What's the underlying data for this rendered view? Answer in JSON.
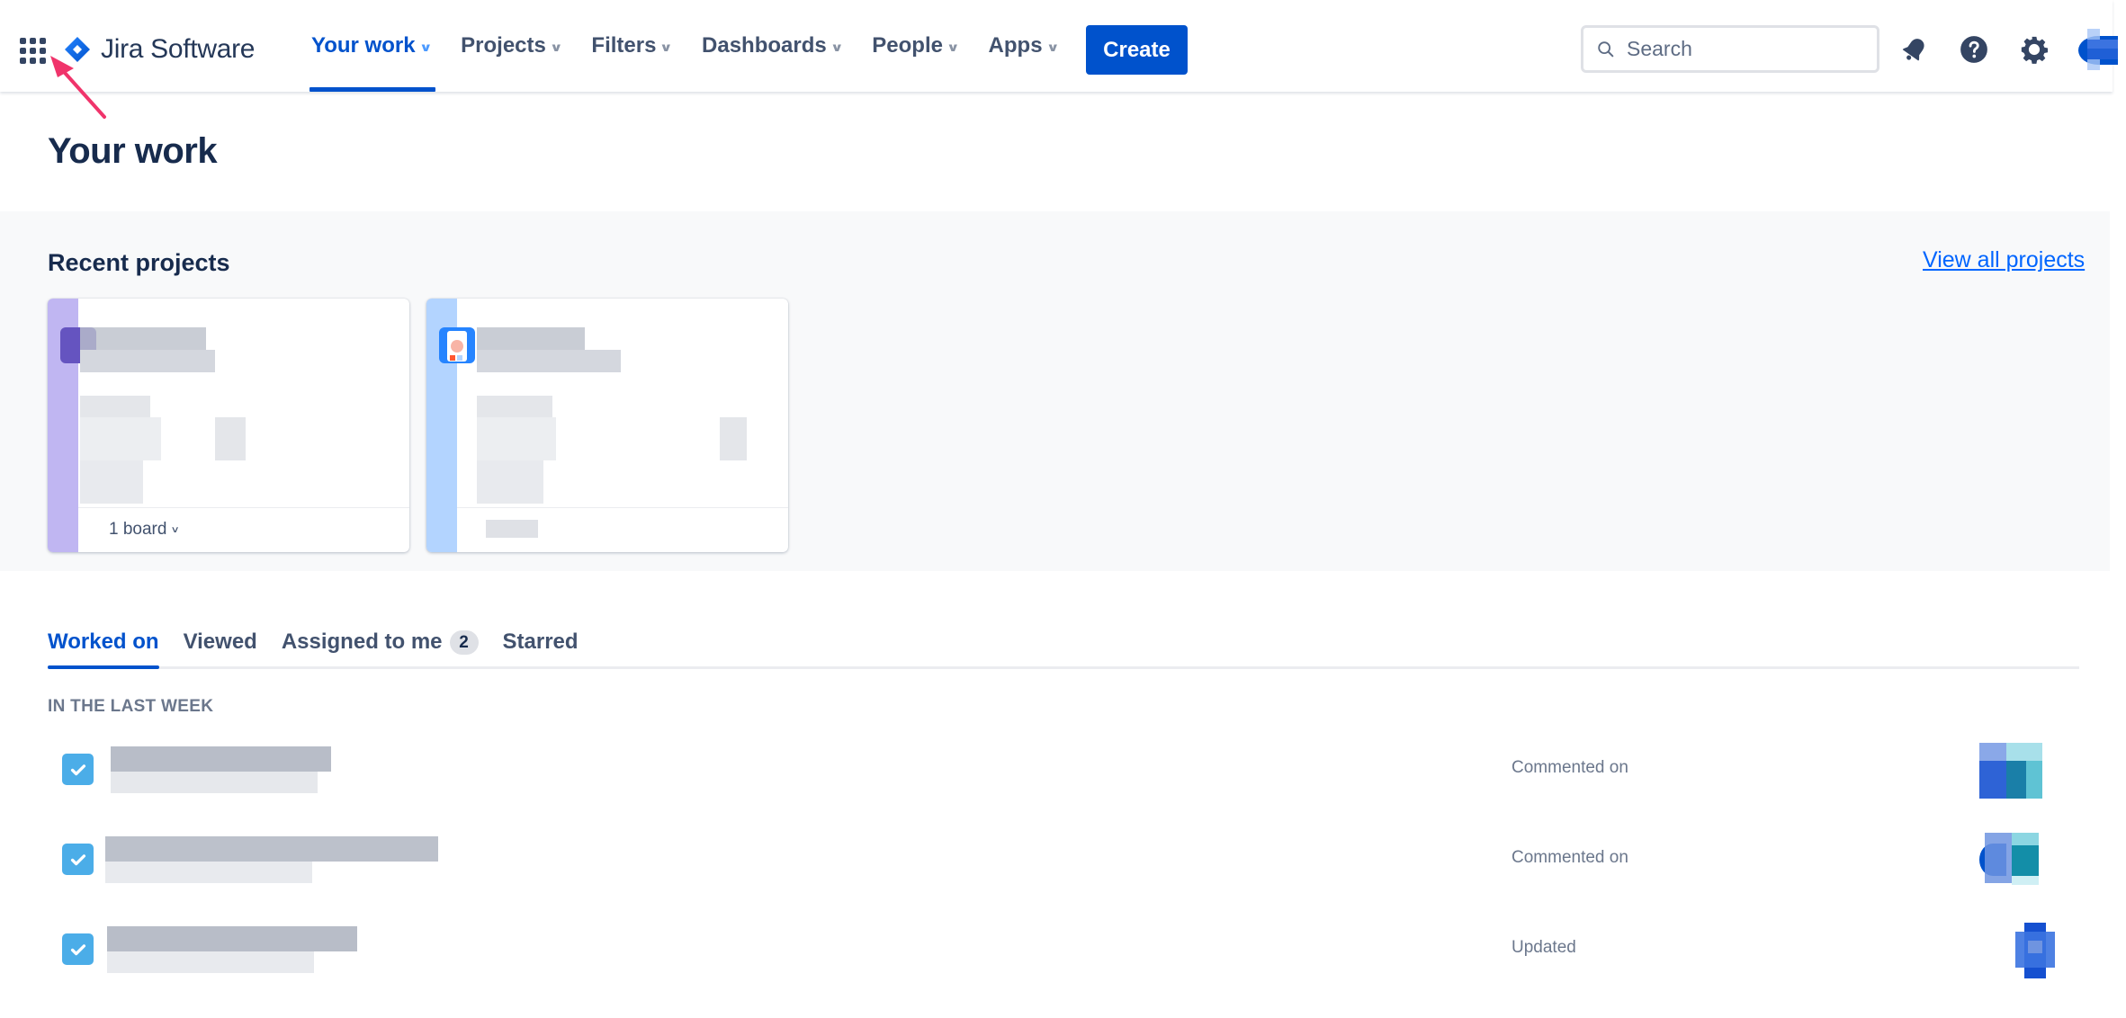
{
  "header": {
    "app_switcher_icon": "apps-grid-icon",
    "product_name": "Jira Software",
    "nav": [
      {
        "label": "Your work",
        "active": true
      },
      {
        "label": "Projects",
        "active": false
      },
      {
        "label": "Filters",
        "active": false
      },
      {
        "label": "Dashboards",
        "active": false
      },
      {
        "label": "People",
        "active": false
      },
      {
        "label": "Apps",
        "active": false
      }
    ],
    "create_label": "Create",
    "search_placeholder": "Search",
    "icons": [
      "notifications-bell-icon",
      "help-icon",
      "settings-gear-icon",
      "avatar"
    ]
  },
  "page": {
    "title": "Your work"
  },
  "recent_projects": {
    "title": "Recent projects",
    "view_all_label": "View all projects",
    "cards": [
      {
        "name": "[redacted]",
        "boards_label": "1 board",
        "stripe_color": "#c0b6f2",
        "icon_color": "#6554c0"
      },
      {
        "name": "[redacted]",
        "boards_label": "",
        "stripe_color": "#b3d4ff",
        "icon_color": "#2684ff"
      }
    ]
  },
  "tabs": [
    {
      "label": "Worked on",
      "active": true
    },
    {
      "label": "Viewed",
      "active": false
    },
    {
      "label": "Assigned to me",
      "active": false,
      "count": "2"
    },
    {
      "label": "Starred",
      "active": false
    }
  ],
  "worked_on": {
    "section_label": "IN THE LAST WEEK",
    "items": [
      {
        "title": "[redacted]",
        "type_icon": "task-checkbox-icon",
        "action": "Commented on"
      },
      {
        "title": "[redacted]",
        "type_icon": "task-checkbox-icon",
        "action": "Commented on"
      },
      {
        "title": "[redacted]",
        "type_icon": "task-checkbox-icon",
        "action": "Updated"
      }
    ]
  },
  "colors": {
    "brand": "#0052cc",
    "link": "#0065ff",
    "text": "#172b4d",
    "subtle_text": "#6b778c",
    "task_icon": "#4bade8",
    "annotation": "#f0346b"
  }
}
